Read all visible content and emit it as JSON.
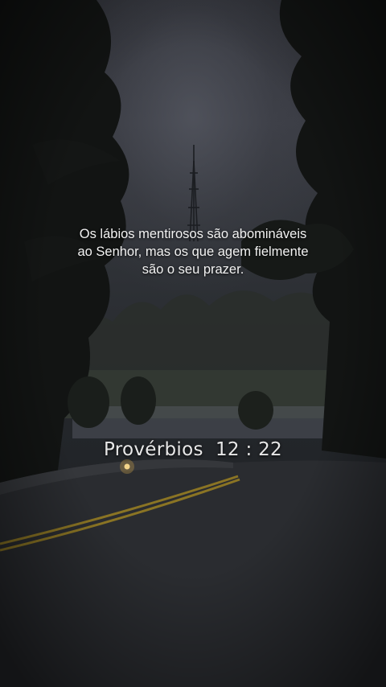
{
  "verse": {
    "lines": [
      "Os lábios mentirosos são abomináveis",
      "ao Senhor, mas os que agem fielmente",
      "são o seu prazer."
    ],
    "reference": "Provérbios  12 : 22"
  },
  "scene": {
    "description_icons": [
      "radio-tower-icon",
      "car-headlight-icon"
    ]
  }
}
